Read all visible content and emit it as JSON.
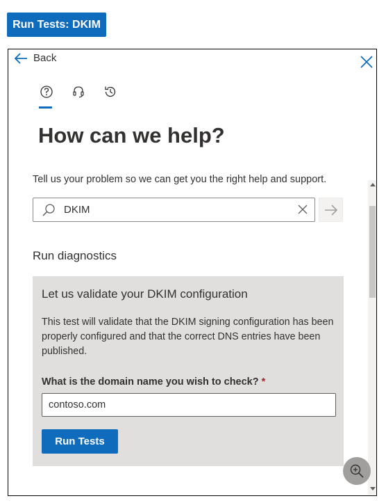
{
  "top_button": {
    "label": "Run Tests: DKIM"
  },
  "panel": {
    "back_label": "Back",
    "tabs": [
      {
        "name": "help",
        "icon": "question-circle-icon",
        "selected": true
      },
      {
        "name": "contact-support",
        "icon": "headset-icon",
        "selected": false
      },
      {
        "name": "history",
        "icon": "history-icon",
        "selected": false
      }
    ],
    "heading": "How can we help?",
    "description": "Tell us your problem so we can get you the right help and support.",
    "search": {
      "value": "DKIM",
      "placeholder": ""
    },
    "section_title": "Run diagnostics",
    "diagnostic": {
      "title": "Let us validate your DKIM configuration",
      "text": "This test will validate that the DKIM signing configuration has been properly configured and that the correct DNS entries have been published.",
      "field_label": "What is the domain name you wish to check?",
      "required_mark": "*",
      "domain_value": "contoso.com",
      "run_label": "Run Tests"
    }
  },
  "colors": {
    "accent": "#0f6cbd",
    "card_bg": "#e1dfdd",
    "required": "#a4262c"
  }
}
